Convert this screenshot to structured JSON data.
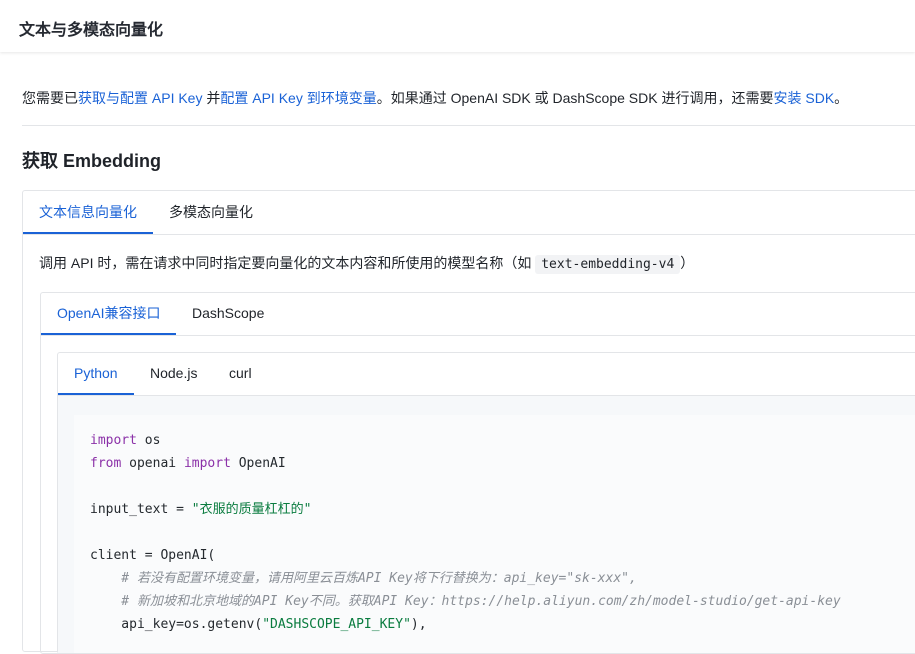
{
  "topbar": {
    "title": "文本与多模态向量化"
  },
  "intro": {
    "prefix": "您需要已",
    "link1": "获取与配置 API Key",
    "mid1": "并",
    "link2": "配置 API Key 到环境变量",
    "mid2": "。如果通过 OpenAI SDK 或 DashScope SDK 进行调用，还需要",
    "link3": "安装 SDK",
    "suffix": "。"
  },
  "section": {
    "heading": "获取 Embedding"
  },
  "outer_tabs": [
    {
      "label": "文本信息向量化",
      "active": true
    },
    {
      "label": "多模态向量化",
      "active": false
    }
  ],
  "description": {
    "text": "调用 API 时，需在请求中同时指定要向量化的文本内容和所使用的模型名称（如 ",
    "model": "text-embedding-v4",
    "suffix": "）"
  },
  "mid_tabs": [
    {
      "label": "OpenAI兼容接口",
      "active": true
    },
    {
      "label": "DashScope",
      "active": false
    }
  ],
  "lang_tabs": [
    {
      "label": "Python",
      "active": true
    },
    {
      "label": "Node.js",
      "active": false
    },
    {
      "label": "curl",
      "active": false
    }
  ],
  "code": {
    "l1_kw": "import",
    "l1_rest": " os",
    "l2_kw1": "from",
    "l2_mid": " openai ",
    "l2_kw2": "import",
    "l2_rest": " OpenAI",
    "l4_var": "input_text = ",
    "l4_str": "\"衣服的质量杠杠的\"",
    "l6": "client = OpenAI(",
    "l7": "    # 若没有配置环境变量，请用阿里云百炼API Key将下行替换为：api_key=\"sk-xxx\",",
    "l8": "    # 新加坡和北京地域的API Key不同。获取API Key：https://help.aliyun.com/zh/model-studio/get-api-key",
    "l9_pre": "    api_key=os.getenv(",
    "l9_str": "\"DASHSCOPE_API_KEY\"",
    "l9_post": "),"
  },
  "colors": {
    "accent": "#1a62d6",
    "keyword": "#8b31a8",
    "string": "#0a7c3f",
    "comment": "#8a8f96"
  }
}
